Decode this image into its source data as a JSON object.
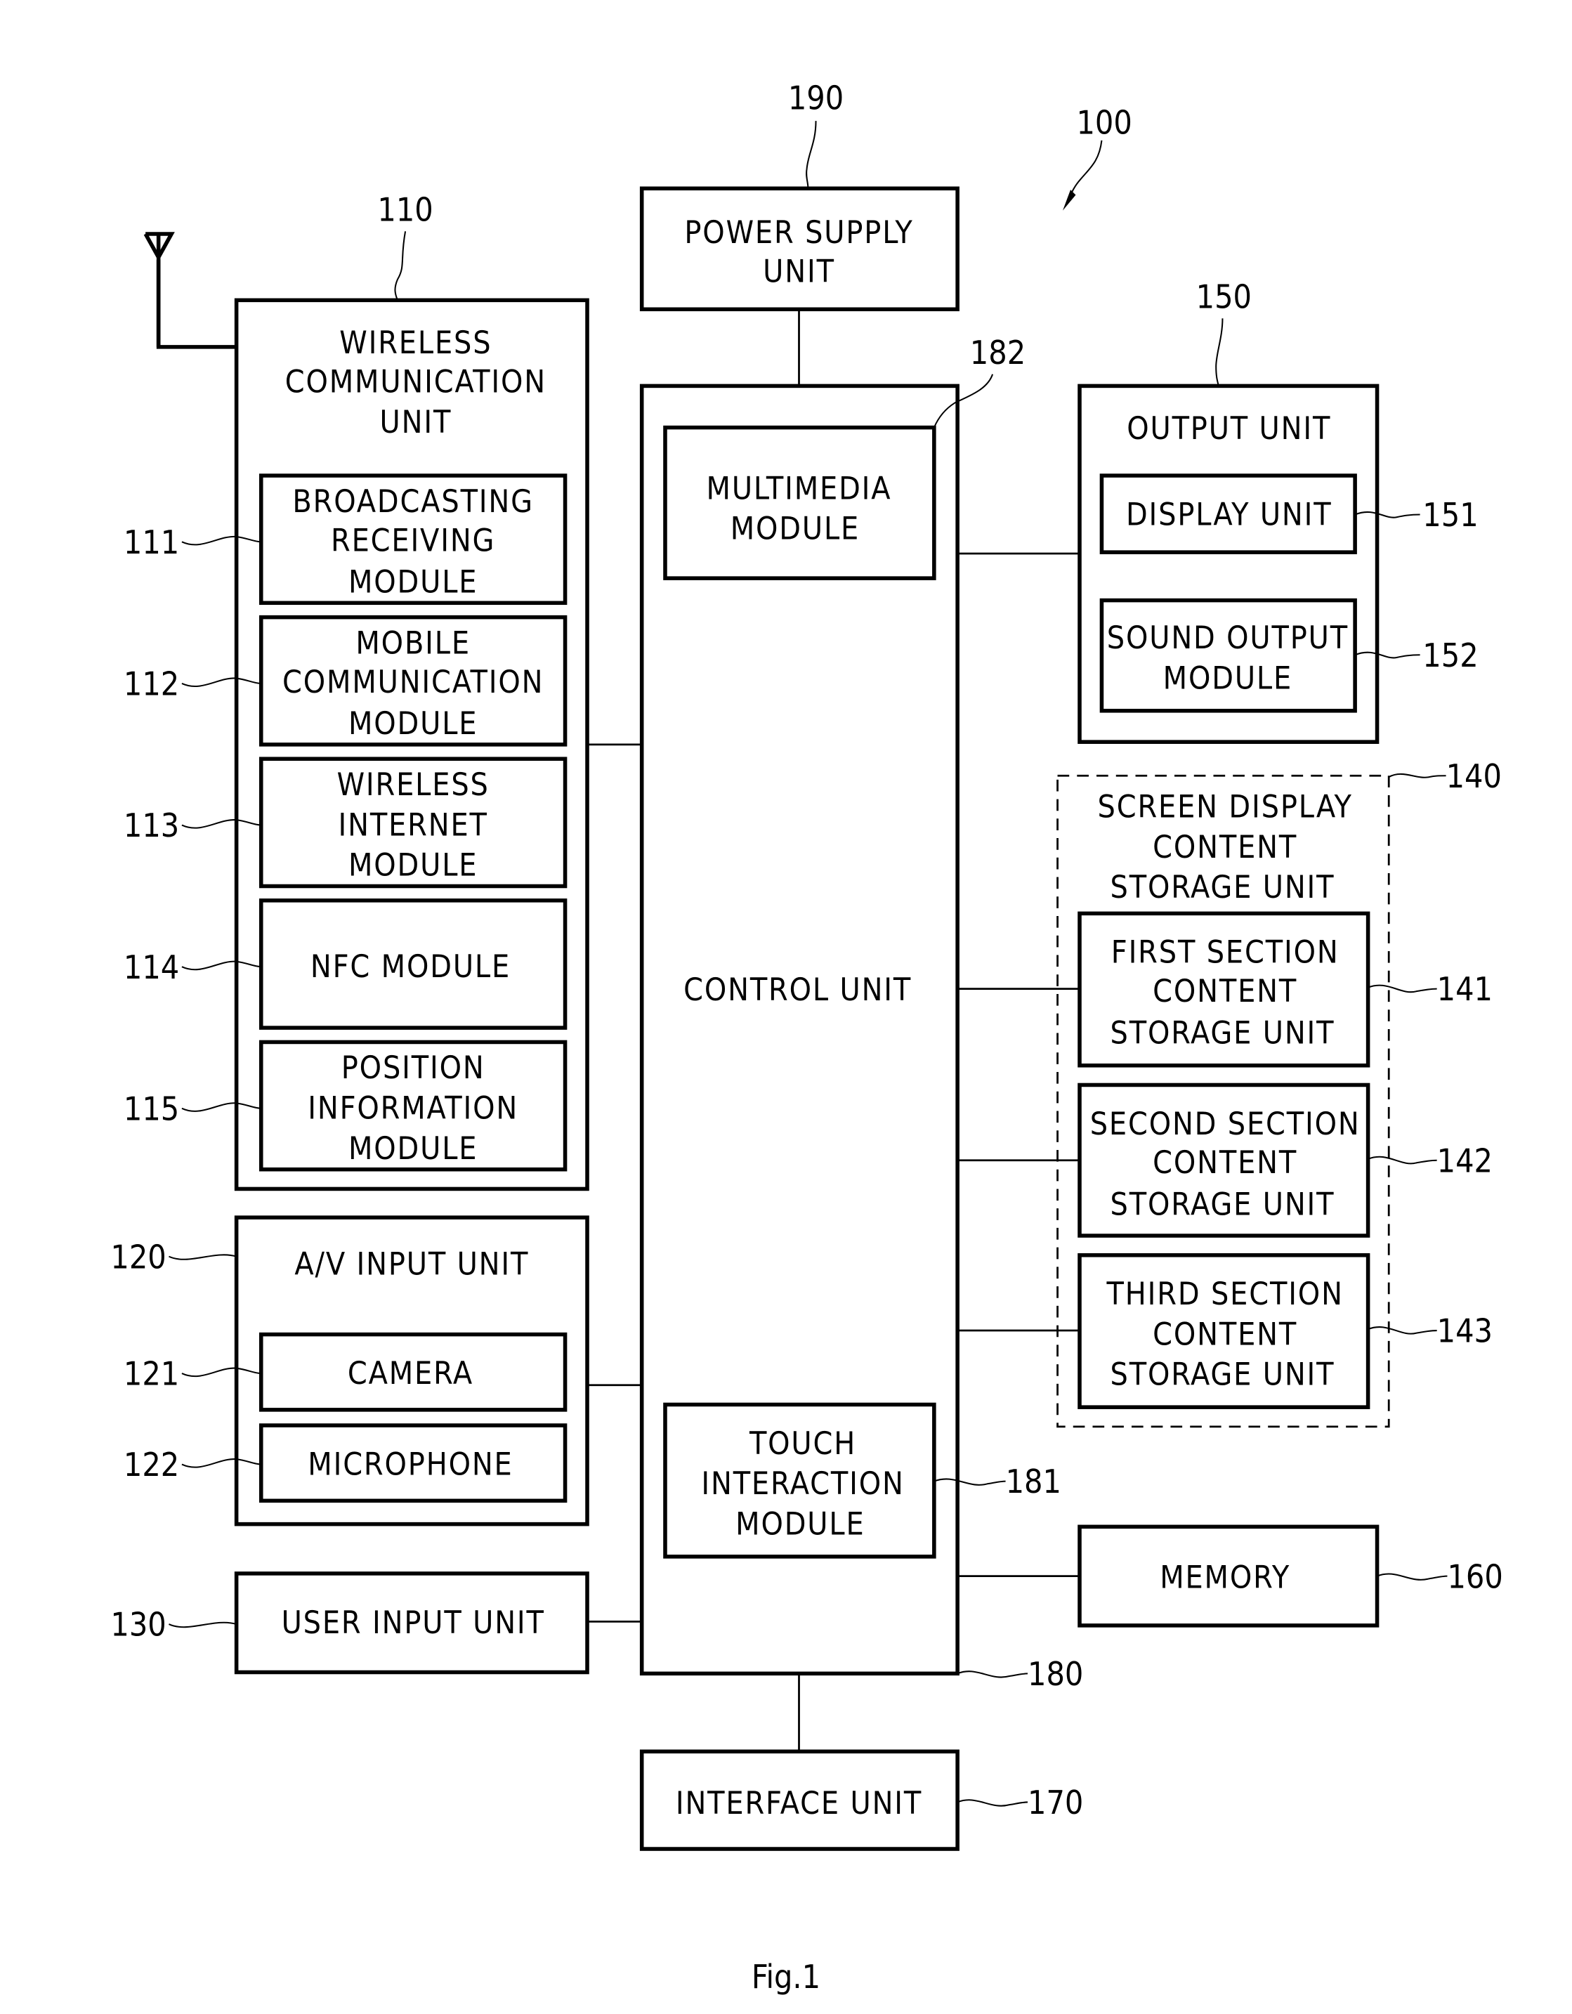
{
  "figure": {
    "caption": "Fig.1",
    "device_ref": "100"
  },
  "blocks": {
    "wireless": {
      "ref": "110",
      "lines": [
        "WIRELESS",
        "COMMUNICATION",
        "UNIT"
      ]
    },
    "broadcast": {
      "ref": "111",
      "lines": [
        "BROADCASTING",
        "RECEIVING",
        "MODULE"
      ]
    },
    "mobile": {
      "ref": "112",
      "lines": [
        "MOBILE",
        "COMMUNICATION",
        "MODULE"
      ]
    },
    "winternet": {
      "ref": "113",
      "lines": [
        "WIRELESS",
        "INTERNET",
        "MODULE"
      ]
    },
    "nfc": {
      "ref": "114",
      "lines": [
        "NFC MODULE"
      ]
    },
    "position": {
      "ref": "115",
      "lines": [
        "POSITION",
        "INFORMATION",
        "MODULE"
      ]
    },
    "av": {
      "ref": "120",
      "lines": [
        "A/V INPUT UNIT"
      ]
    },
    "camera": {
      "ref": "121",
      "lines": [
        "CAMERA"
      ]
    },
    "mic": {
      "ref": "122",
      "lines": [
        "MICROPHONE"
      ]
    },
    "userinput": {
      "ref": "130",
      "lines": [
        "USER INPUT UNIT"
      ]
    },
    "power": {
      "ref": "190",
      "lines": [
        "POWER SUPPLY",
        "UNIT"
      ]
    },
    "control": {
      "ref": "180",
      "lines": [
        "CONTROL UNIT"
      ]
    },
    "multimedia": {
      "ref": "182",
      "lines": [
        "MULTIMEDIA",
        "MODULE"
      ]
    },
    "touch": {
      "ref": "181",
      "lines": [
        "TOUCH",
        "INTERACTION",
        "MODULE"
      ]
    },
    "interface": {
      "ref": "170",
      "lines": [
        "INTERFACE UNIT"
      ]
    },
    "output": {
      "ref": "150",
      "lines": [
        "OUTPUT UNIT"
      ]
    },
    "display": {
      "ref": "151",
      "lines": [
        "DISPLAY UNIT"
      ]
    },
    "sound": {
      "ref": "152",
      "lines": [
        "SOUND OUTPUT",
        "MODULE"
      ]
    },
    "screenstore": {
      "ref": "140",
      "lines": [
        "SCREEN DISPLAY",
        "CONTENT",
        "STORAGE UNIT"
      ]
    },
    "first": {
      "ref": "141",
      "lines": [
        "FIRST SECTION",
        "CONTENT",
        "STORAGE UNIT"
      ]
    },
    "second": {
      "ref": "142",
      "lines": [
        "SECOND SECTION",
        "CONTENT",
        "STORAGE UNIT"
      ]
    },
    "third": {
      "ref": "143",
      "lines": [
        "THIRD SECTION",
        "CONTENT",
        "STORAGE UNIT"
      ]
    },
    "memory": {
      "ref": "160",
      "lines": [
        "MEMORY"
      ]
    }
  }
}
